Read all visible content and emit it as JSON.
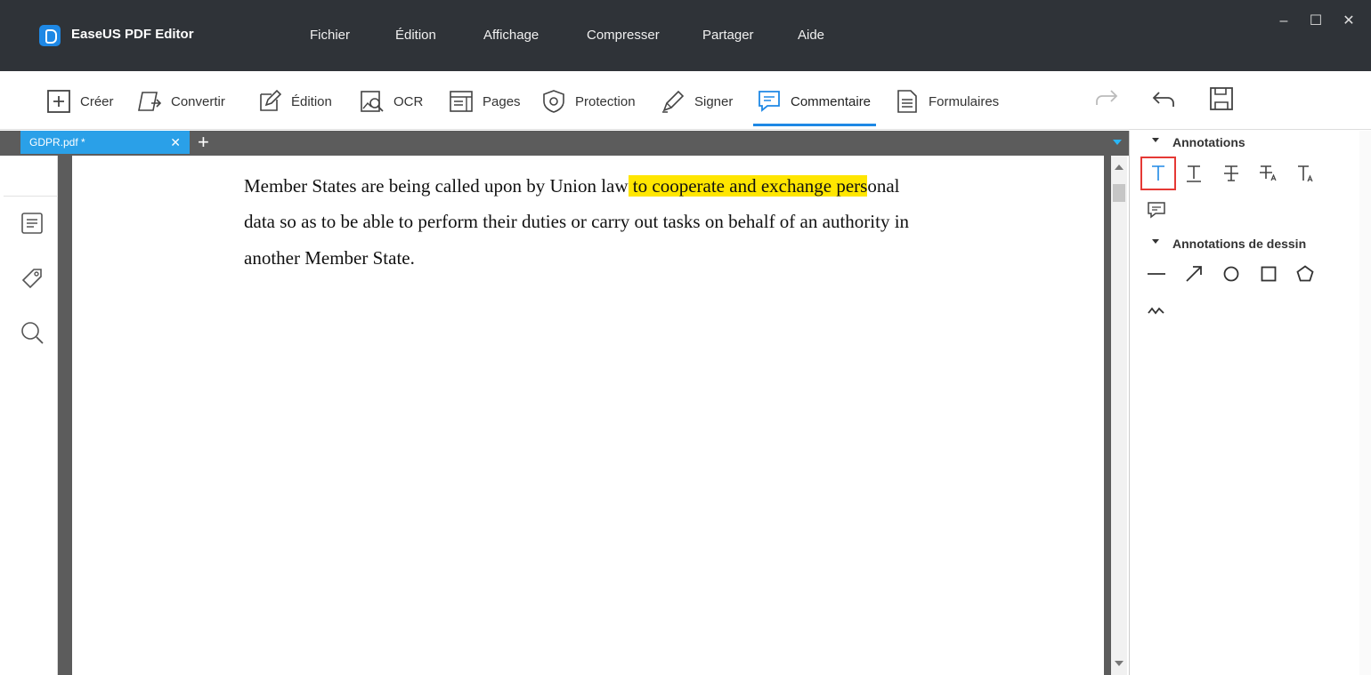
{
  "app": {
    "title": "EaseUS PDF Editor"
  },
  "menu": [
    "Fichier",
    "Édition",
    "Affichage",
    "Compresser",
    "Partager",
    "Aide"
  ],
  "window_controls": {
    "minimize": "–",
    "maximize": "☐",
    "close": "✕"
  },
  "toolbar": {
    "items": [
      {
        "label": "Créer",
        "icon": "plus-square-icon"
      },
      {
        "label": "Convertir",
        "icon": "convert-icon"
      },
      {
        "label": "Édition",
        "icon": "edit-icon"
      },
      {
        "label": "OCR",
        "icon": "ocr-icon"
      },
      {
        "label": "Pages",
        "icon": "pages-icon"
      },
      {
        "label": "Protection",
        "icon": "shield-icon"
      },
      {
        "label": "Signer",
        "icon": "pen-icon"
      },
      {
        "label": "Commentaire",
        "icon": "comment-icon"
      },
      {
        "label": "Formulaires",
        "icon": "form-icon"
      }
    ],
    "active": "Commentaire",
    "accent": "#1e88e5"
  },
  "tabs": [
    {
      "label": "GDPR.pdf *",
      "close": "✕"
    }
  ],
  "tab_add": "+",
  "document": {
    "lines": {
      "l1_before": "Member States are being called upon by Union law",
      "l1_highlight": " to cooperate and exchange pers",
      "l1_after": "onal",
      "l2": "data so as to be able to perform their duties or carry out tasks on behalf of an authority in",
      "l3": "another Member State."
    },
    "highlight_color": "#ffe600"
  },
  "right_panel": {
    "annotations_title": "Annotations",
    "drawing_title": "Annotations de dessin",
    "annotation_tools": [
      "text-cursor-icon",
      "text-insert-icon",
      "strikethrough-icon",
      "replace-text-icon",
      "text-size-icon",
      "note-comment-icon"
    ],
    "drawing_tools": [
      "line-icon",
      "arrow-icon",
      "circle-icon",
      "rectangle-icon",
      "polygon-icon",
      "freehand-icon"
    ],
    "selected_tool": "text-cursor-icon",
    "selected_color": "#e53935"
  }
}
